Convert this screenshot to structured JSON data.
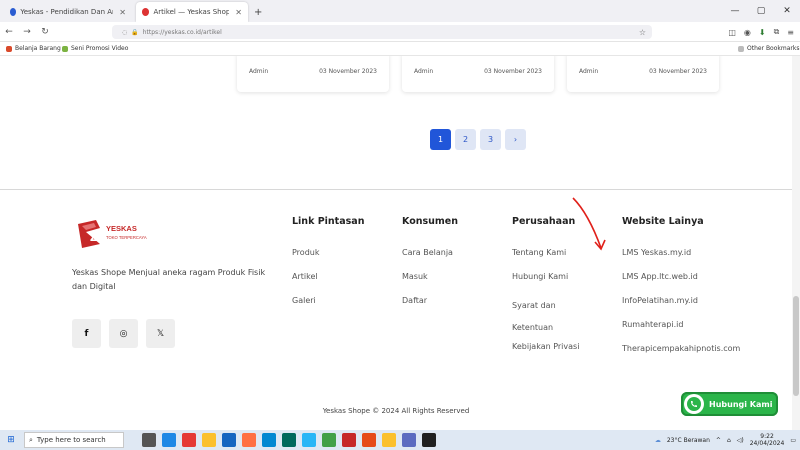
{
  "browser": {
    "tabs": [
      {
        "label": "Yeskas - Pendidikan Dan Amal | K",
        "active": false,
        "favicon_color": "#2a5cd1"
      },
      {
        "label": "Artikel — Yeskas Shope",
        "active": true,
        "favicon_color": "#d33"
      }
    ],
    "new_tab": "+",
    "window_controls": [
      "—",
      "▢",
      "✕"
    ],
    "url": "https://yeskas.co.id/artikel",
    "bookmarks": [
      {
        "label": "Belanja Barang",
        "color": "#d94a2b"
      },
      {
        "label": "Seni Promosi Video",
        "color": "#7cb342"
      }
    ],
    "other_bookmarks": "Other Bookmarks"
  },
  "articles": [
    {
      "author": "Admin",
      "date": "03 November 2023"
    },
    {
      "author": "Admin",
      "date": "03 November 2023"
    },
    {
      "author": "Admin",
      "date": "03 November 2023"
    }
  ],
  "pagination": {
    "pages": [
      "1",
      "2",
      "3"
    ],
    "next": "›",
    "active": "1"
  },
  "footer": {
    "logo_text": "YESKAS",
    "logo_tagline": "TOKO TERPERCAYA",
    "about": "Yeskas Shope Menjual aneka ragam Produk Fisik dan Digital",
    "social": [
      {
        "icon": "facebook-icon",
        "glyph": "f"
      },
      {
        "icon": "instagram-icon",
        "glyph": "◎"
      },
      {
        "icon": "x-icon",
        "glyph": "𝕏"
      }
    ],
    "columns": [
      {
        "title": "Link Pintasan",
        "links": [
          "Produk",
          "Artikel",
          "Galeri"
        ]
      },
      {
        "title": "Konsumen",
        "links": [
          "Cara Belanja",
          "Masuk",
          "Daftar"
        ]
      },
      {
        "title": "Perusahaan",
        "links": [
          "Tentang Kami",
          "Hubungi Kami",
          "Syarat dan Ketentuan",
          "Kebijakan Privasi"
        ]
      },
      {
        "title": "Website Lainya",
        "links": [
          "LMS Yeskas.my.id",
          "LMS App.ltc.web.id",
          "InfoPelatihan.my.id",
          "Rumahterapi.id",
          "Therapicempakahipnotis.com"
        ]
      }
    ],
    "copyright": "Yeskas Shope © 2024 All Rights Reserved"
  },
  "whatsapp_button": "Hubungi Kami",
  "taskbar": {
    "search_placeholder": "Type here to search",
    "weather": "23°C Berawan",
    "time": "9:22",
    "date": "24/04/2024",
    "app_colors": [
      "#555",
      "#1e88e5",
      "#e53935",
      "#fbc02d",
      "#1565c0",
      "#ff7043",
      "#0288d1",
      "#00695c",
      "#29b6f6",
      "#43a047",
      "#c62828",
      "#e64a19",
      "#fbc02d",
      "#5c6bc0",
      "#212121"
    ]
  },
  "colors": {
    "accent": "#2156d9",
    "whatsapp": "#2bb54a",
    "annotation_arrow": "#e0201a"
  }
}
